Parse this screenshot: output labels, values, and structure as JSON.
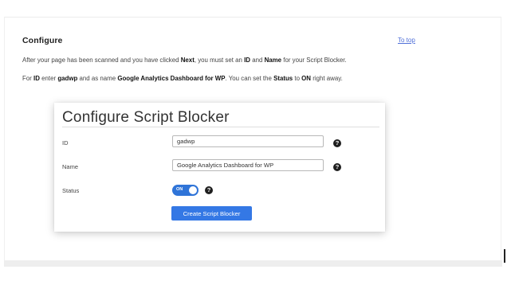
{
  "section": {
    "title": "Configure",
    "to_top_label": "To top"
  },
  "paragraph1": {
    "t1": "After your page has been scanned and you have clicked ",
    "b1": "Next",
    "t2": ", you must set an ",
    "b2": "ID",
    "t3": " and ",
    "b3": "Name",
    "t4": " for your Script Blocker."
  },
  "paragraph2": {
    "t1": "For ",
    "b1": "ID",
    "t2": " enter ",
    "b2": "gadwp",
    "t3": " and as name ",
    "b3": "Google Analytics Dashboard for WP",
    "t4": ". You can set the ",
    "b4": "Status",
    "t5": " to ",
    "b5": "ON",
    "t6": " right away."
  },
  "screenshot": {
    "title": "Configure Script Blocker",
    "id_label": "ID",
    "id_value": "gadwp",
    "name_label": "Name",
    "name_value": "Google Analytics Dashboard for WP",
    "status_label": "Status",
    "status_toggle_text": "ON",
    "help_glyph": "?",
    "create_button_label": "Create Script Blocker"
  },
  "colors": {
    "accent": "#3478e5",
    "link": "#4f6fd8",
    "help_icon": "#1f1f1f"
  },
  "icons": {
    "help": "question-circle-icon"
  }
}
